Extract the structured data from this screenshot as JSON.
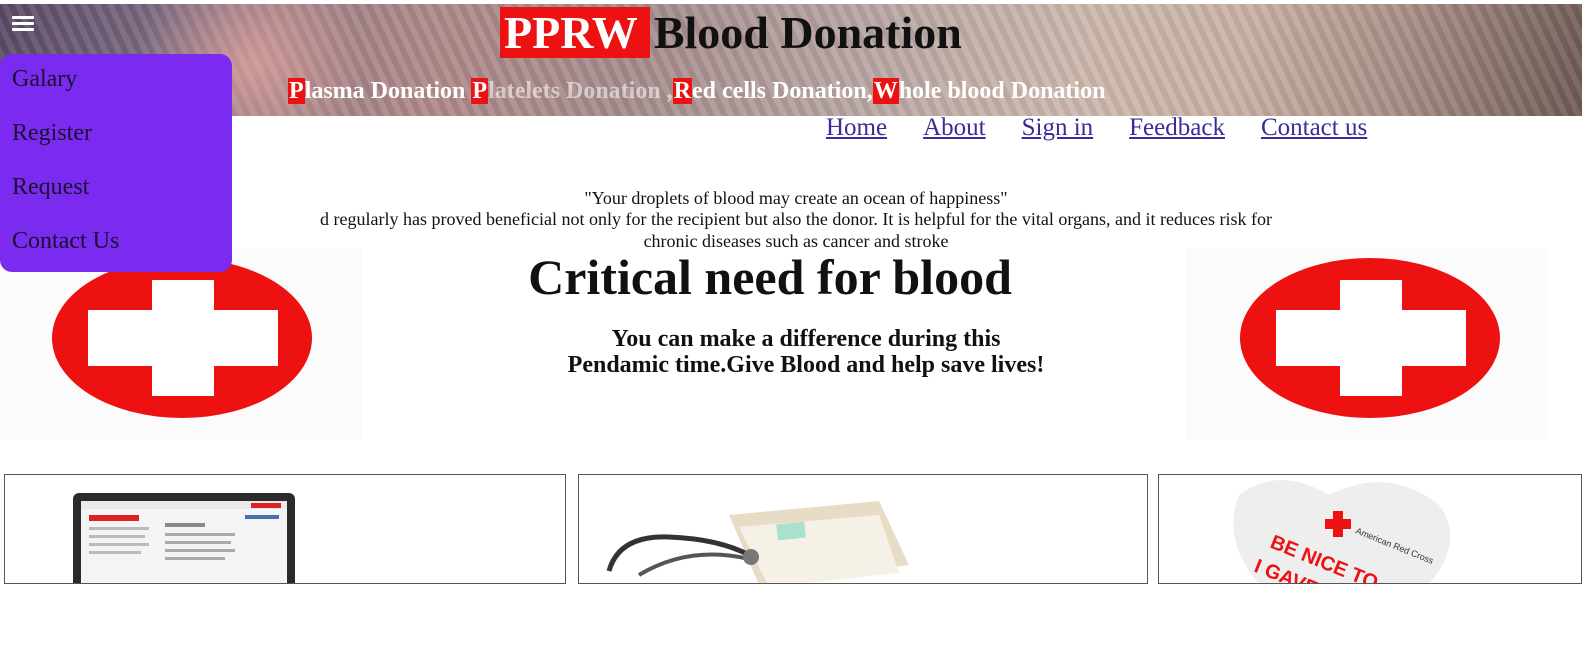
{
  "header": {
    "brand": "PPRW",
    "title_rest": "Blood Donation",
    "subtitle": [
      {
        "cap": "P",
        "text": "lasma Donation ",
        "faded": false
      },
      {
        "cap": "P",
        "text": "latelets Donation ,",
        "faded": true
      },
      {
        "cap": "R",
        "text": "ed cells Donation,",
        "faded": false
      },
      {
        "cap": "W",
        "text": "hole blood Donation",
        "faded": false
      }
    ]
  },
  "nav": {
    "home": "Home",
    "about": "About",
    "signin": "Sign in",
    "feedback": "Feedback",
    "contact": "Contact us"
  },
  "sidemenu": {
    "items": [
      "Galary",
      "Register",
      "Request",
      "Contact Us"
    ]
  },
  "main": {
    "quote": "\"Your droplets of blood may create an ocean of happiness\"",
    "para_line1": "d regularly has proved beneficial not only for the recipient but also the donor. It is helpful for the vital organs, and it reduces risk for",
    "para_line2": "chronic diseases such as cancer and stroke",
    "headline": "Critical need for blood",
    "tagline1": "You can make a difference during this",
    "tagline2": "Pendamic time.Give Blood and help save lives!"
  },
  "cards": {
    "card3_text1": "BE NICE TO",
    "card3_text2": "I GAVE",
    "card3_logo": "American Red Cross"
  },
  "colors": {
    "accent_red": "#ee1111",
    "menu_purple": "#7b2bf0",
    "link": "#3b2b9a"
  },
  "icons": {
    "menu": "hamburger-icon",
    "cross": "red-cross-icon"
  }
}
